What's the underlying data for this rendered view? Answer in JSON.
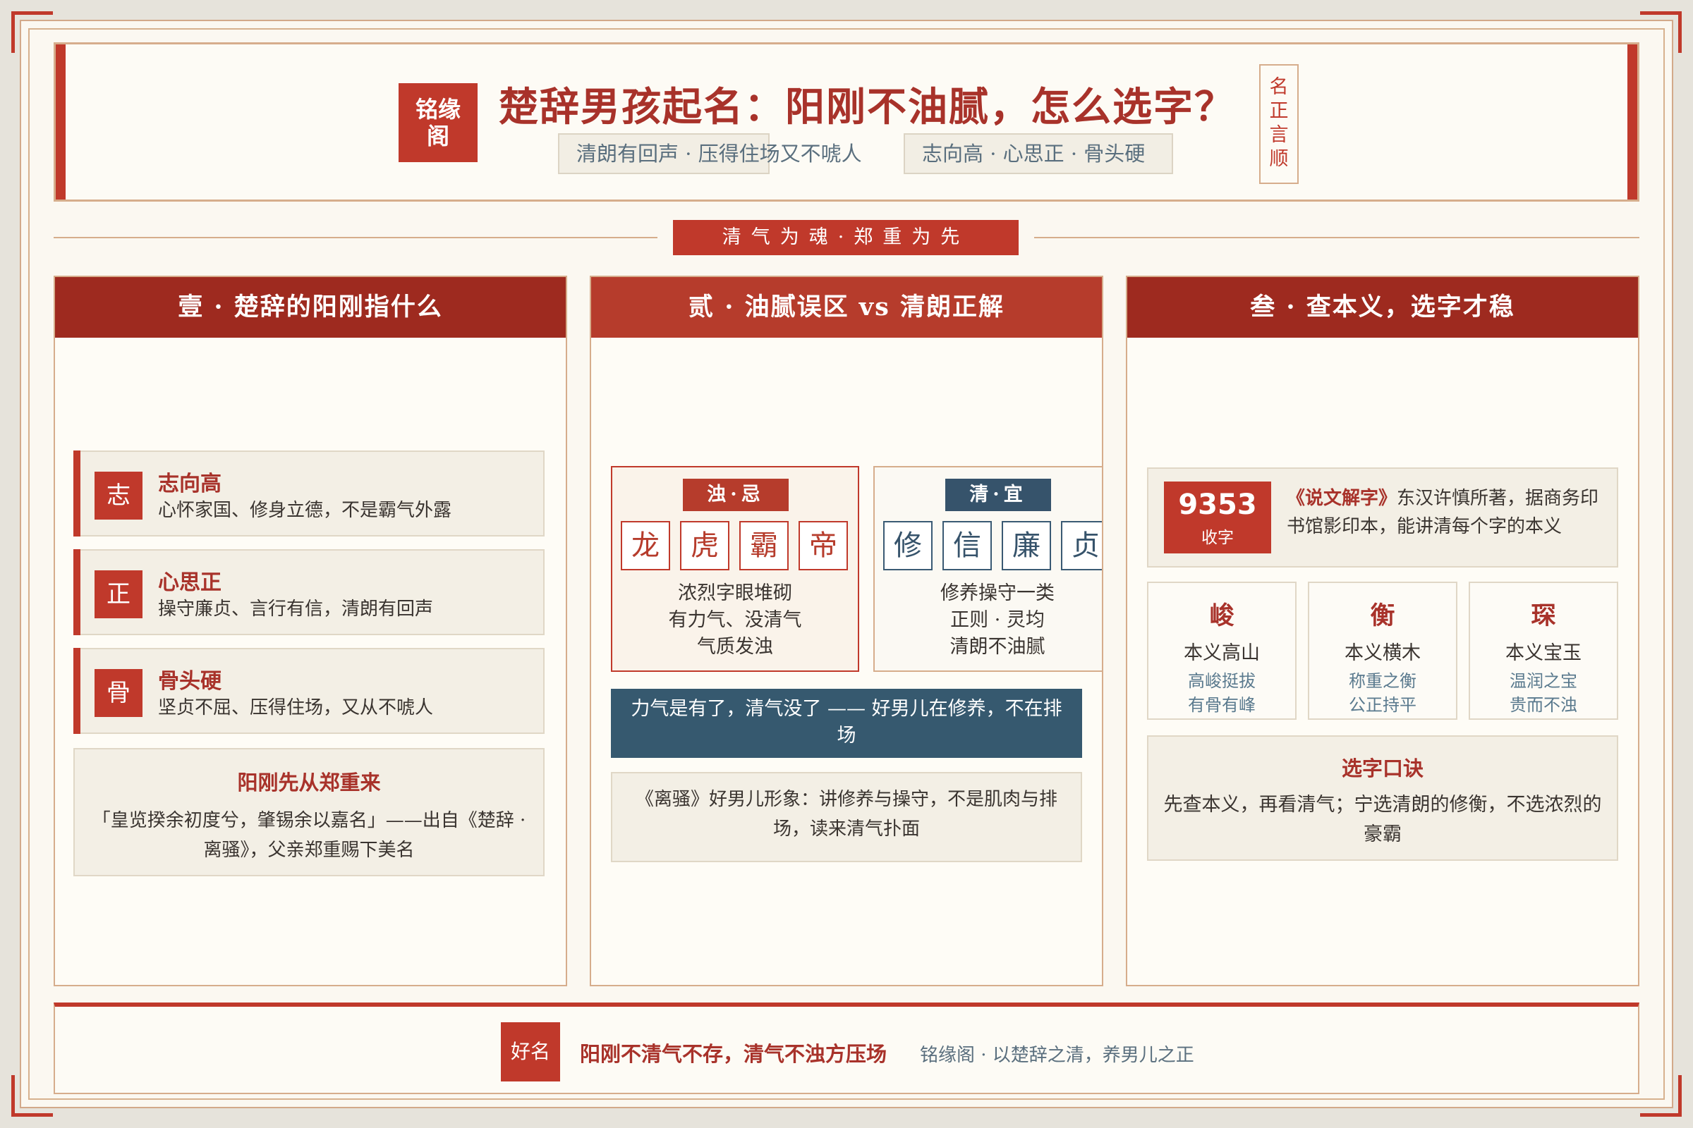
{
  "header": {
    "logo": "铭缘阁",
    "title": "楚辞男孩起名：阳刚不油腻，怎么选字？",
    "tags": [
      "清朗有回声 · 压得住场又不唬人",
      "志向高 · 心思正 · 骨头硬"
    ],
    "seal": "名正言顺"
  },
  "motto": "清气为魂·郑重为先",
  "panel1": {
    "title": "壹 · 楚辞的阳刚指什么",
    "virtues": [
      {
        "char": "志",
        "title": "志向高",
        "desc": "心怀家国、修身立德，不是霸气外露"
      },
      {
        "char": "正",
        "title": "心思正",
        "desc": "操守廉贞、言行有信，清朗有回声"
      },
      {
        "char": "骨",
        "title": "骨头硬",
        "desc": "坚贞不屈、压得住场，又从不唬人"
      }
    ],
    "quote": {
      "title": "阳刚先从郑重来",
      "text": "「皇览揆余初度兮，肇锡余以嘉名」——出自《楚辞 · 离骚》，父亲郑重赐下美名"
    }
  },
  "panel2": {
    "title": "贰 · 油腻误区 vs 清朗正解",
    "bad": {
      "label": "浊·忌",
      "chars": [
        "龙",
        "虎",
        "霸",
        "帝"
      ],
      "desc": [
        "浓烈字眼堆砌",
        "有力气、没清气",
        "气质发浊"
      ]
    },
    "good": {
      "label": "清·宜",
      "chars": [
        "修",
        "信",
        "廉",
        "贞"
      ],
      "desc": [
        "修养操守一类",
        "正则 · 灵均",
        "清朗不油腻"
      ]
    },
    "banner": "力气是有了，清气没了 —— 好男儿在修养，不在排场",
    "lisao": "《离骚》好男儿形象：讲修养与操守，不是肌肉与排场，读来清气扑面"
  },
  "panel3": {
    "title": "叁 · 查本义，选字才稳",
    "stat": {
      "number": "9353",
      "unit": "收字"
    },
    "shuowen_book": "《说文解字》",
    "shuowen_text": "东汉许慎所著，据商务印书馆影印本，能讲清每个字的本义",
    "chars": [
      {
        "char": "峻",
        "meaning": "本义高山",
        "lines": [
          "高峻挺拔",
          "有骨有峰"
        ]
      },
      {
        "char": "衡",
        "meaning": "本义横木",
        "lines": [
          "称重之衡",
          "公正持平"
        ]
      },
      {
        "char": "琛",
        "meaning": "本义宝玉",
        "lines": [
          "温润之宝",
          "贵而不浊"
        ]
      }
    ],
    "koujue": {
      "title": "选字口诀",
      "text": "先查本义，再看清气；宁选清朗的修衡，不选浓烈的豪霸"
    }
  },
  "footer": {
    "badge": "好名",
    "main": "阳刚不清气不存，清气不浊方压场",
    "sub": "铭缘阁 · 以楚辞之清，养男儿之正"
  },
  "colors": {
    "accent": "#c0392b",
    "dark_red": "#9e2a1f",
    "slate": "#36596f",
    "paper": "#fbf8f1",
    "gold_border": "#d6ad8c"
  }
}
